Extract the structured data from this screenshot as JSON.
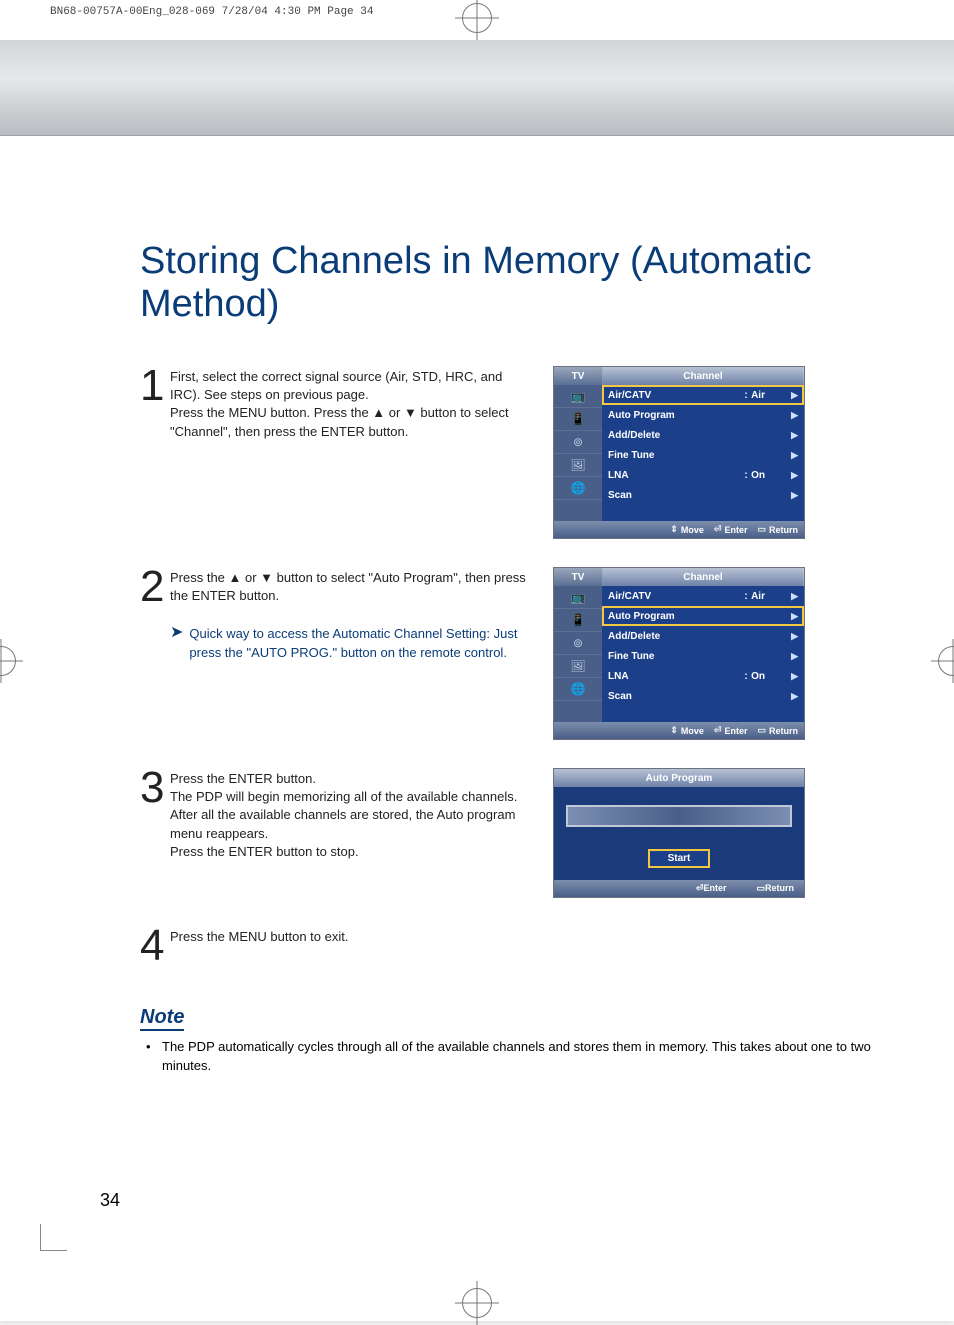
{
  "print_header": "BN68-00757A-00Eng_028-069  7/28/04  4:30 PM  Page 34",
  "page_number": "34",
  "title": "Storing Channels in Memory (Automatic Method)",
  "steps": [
    {
      "num": "1",
      "text": "First, select the correct signal source (Air, STD, HRC, and IRC). See steps on previous page.\nPress the MENU button. Press the ▲ or ▼ button to select \"Channel\", then press the ENTER button."
    },
    {
      "num": "2",
      "text": "Press the ▲ or ▼ button to select \"Auto Program\", then press the ENTER button.",
      "tip": "Quick way to access the Automatic Channel Setting: Just press the \"AUTO PROG.\" button on the remote control."
    },
    {
      "num": "3",
      "text": "Press the ENTER button.\nThe PDP will begin memorizing all of the available channels.\nAfter all the available channels are stored, the Auto program menu reappears.\nPress the ENTER button to stop."
    },
    {
      "num": "4",
      "text": "Press the MENU button to exit."
    }
  ],
  "osd": {
    "tv_label": "TV",
    "title": "Channel",
    "items": [
      {
        "label": "Air/CATV",
        "value": "Air"
      },
      {
        "label": "Auto Program",
        "value": ""
      },
      {
        "label": "Add/Delete",
        "value": ""
      },
      {
        "label": "Fine Tune",
        "value": ""
      },
      {
        "label": "LNA",
        "value": "On"
      },
      {
        "label": "Scan",
        "value": ""
      }
    ],
    "footer": {
      "move": "Move",
      "enter": "Enter",
      "return": "Return"
    }
  },
  "osd1_selected_index": 0,
  "osd2_selected_index": 1,
  "auto_program": {
    "title": "Auto Program",
    "start": "Start",
    "enter": "Enter",
    "return": "Return"
  },
  "note": {
    "heading": "Note",
    "text": "The PDP automatically cycles through all of the available channels and stores them in memory. This takes about one to two minutes."
  }
}
